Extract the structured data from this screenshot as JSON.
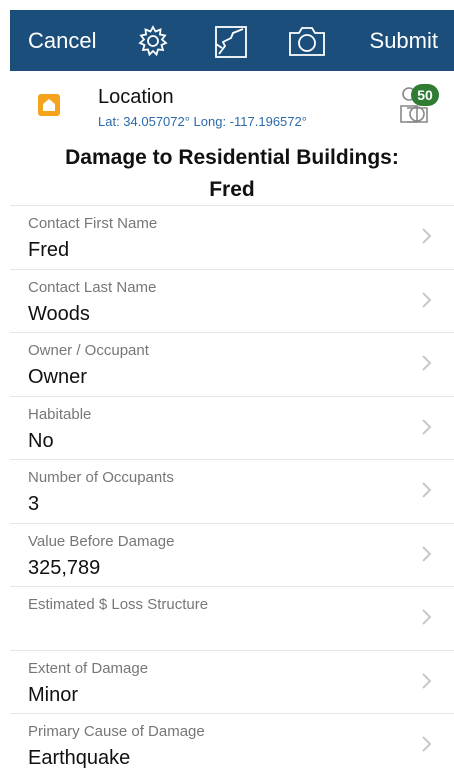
{
  "toolbar": {
    "cancel_label": "Cancel",
    "submit_label": "Submit",
    "icons": [
      "gear-icon",
      "map-icon",
      "camera-icon"
    ],
    "bar_color": "#1c4e7b"
  },
  "location": {
    "title": "Location",
    "coords": "Lat: 34.057072° Long: -117.196572°",
    "photo_count": "50",
    "icon": "home-icon",
    "accent": "#f5a21d"
  },
  "form": {
    "title_line1": "Damage to Residential Buildings:",
    "title_line2": "Fred",
    "fields": [
      {
        "label": "Contact First Name",
        "value": "Fred"
      },
      {
        "label": "Contact Last Name",
        "value": "Woods"
      },
      {
        "label": "Owner / Occupant",
        "value": "Owner"
      },
      {
        "label": "Habitable",
        "value": "No"
      },
      {
        "label": "Number of Occupants",
        "value": "3"
      },
      {
        "label": "Value Before Damage",
        "value": "325,789"
      },
      {
        "label": "Estimated $ Loss Structure",
        "value": ""
      },
      {
        "label": "Extent of Damage",
        "value": "Minor"
      },
      {
        "label": "Primary Cause of Damage",
        "value": "Earthquake"
      }
    ]
  }
}
